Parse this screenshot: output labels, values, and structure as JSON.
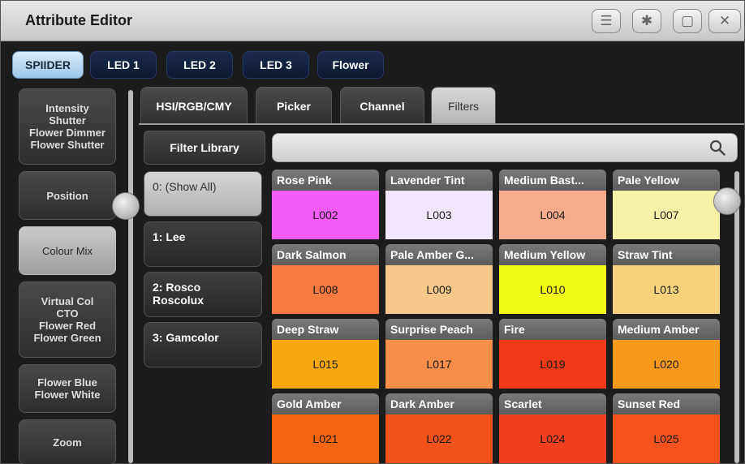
{
  "window": {
    "title": "Attribute Editor"
  },
  "titlebar_icons": [
    "menu-icon",
    "gear-icon",
    "expand-icon",
    "close-icon"
  ],
  "device_tabs": [
    "SPIIDER",
    "LED 1",
    "LED 2",
    "LED 3",
    "Flower"
  ],
  "attribute_groups": [
    {
      "lines": [
        "Intensity",
        "Shutter",
        "Flower Dimmer",
        "Flower Shutter"
      ]
    },
    {
      "lines": [
        "Position"
      ]
    },
    {
      "lines": [
        "Colour Mix"
      ]
    },
    {
      "lines": [
        "Virtual Col",
        "CTO",
        "Flower Red",
        "Flower Green"
      ]
    },
    {
      "lines": [
        "Flower Blue",
        "Flower White"
      ]
    },
    {
      "lines": [
        "Zoom"
      ]
    }
  ],
  "mode_tabs": [
    "HSI/RGB/CMY",
    "Picker",
    "Channel",
    "Filters"
  ],
  "filter_library": {
    "header": "Filter Library",
    "items": [
      "0: (Show All)",
      "1: Lee",
      "2: Rosco Roscolux",
      "3: Gamcolor"
    ]
  },
  "search": {
    "placeholder": ""
  },
  "filters": [
    {
      "name": "Rose Pink",
      "code": "L002",
      "color": "#f35cf5"
    },
    {
      "name": "Lavender Tint",
      "code": "L003",
      "color": "#f1e6fb"
    },
    {
      "name": "Medium Bast...",
      "code": "L004",
      "color": "#f8ab8c"
    },
    {
      "name": "Pale Yellow",
      "code": "L007",
      "color": "#f5f1a8"
    },
    {
      "name": "Dark Salmon",
      "code": "L008",
      "color": "#f6793f"
    },
    {
      "name": "Pale Amber G...",
      "code": "L009",
      "color": "#f6c98a"
    },
    {
      "name": "Medium Yellow",
      "code": "L010",
      "color": "#f2f915"
    },
    {
      "name": "Straw Tint",
      "code": "L013",
      "color": "#f6d27a"
    },
    {
      "name": "Deep Straw",
      "code": "L015",
      "color": "#f6a80d"
    },
    {
      "name": "Surprise Peach",
      "code": "L017",
      "color": "#f78f4b"
    },
    {
      "name": "Fire",
      "code": "L019",
      "color": "#f33a18"
    },
    {
      "name": "Medium Amber",
      "code": "L020",
      "color": "#f79a1c"
    },
    {
      "name": "Gold Amber",
      "code": "L021",
      "color": "#f5640f"
    },
    {
      "name": "Dark Amber",
      "code": "L022",
      "color": "#f2531a"
    },
    {
      "name": "Scarlet",
      "code": "L024",
      "color": "#f2401f"
    },
    {
      "name": "Sunset Red",
      "code": "L025",
      "color": "#f4531e"
    }
  ]
}
